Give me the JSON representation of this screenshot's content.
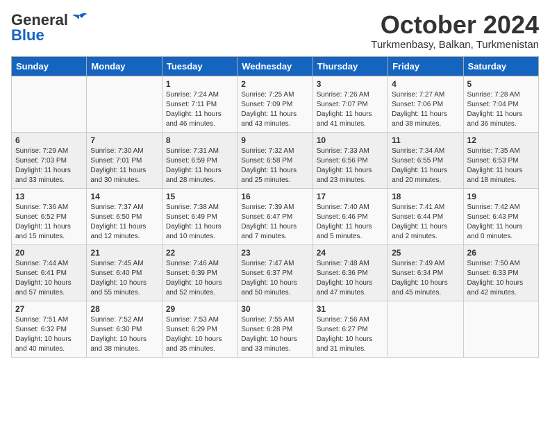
{
  "logo": {
    "general": "General",
    "blue": "Blue",
    "bird_unicode": "🐦"
  },
  "header": {
    "month": "October 2024",
    "location": "Turkmenbasy, Balkan, Turkmenistan"
  },
  "days_of_week": [
    "Sunday",
    "Monday",
    "Tuesday",
    "Wednesday",
    "Thursday",
    "Friday",
    "Saturday"
  ],
  "weeks": [
    [
      {
        "day": "",
        "info": ""
      },
      {
        "day": "",
        "info": ""
      },
      {
        "day": "1",
        "info": "Sunrise: 7:24 AM\nSunset: 7:11 PM\nDaylight: 11 hours and 46 minutes."
      },
      {
        "day": "2",
        "info": "Sunrise: 7:25 AM\nSunset: 7:09 PM\nDaylight: 11 hours and 43 minutes."
      },
      {
        "day": "3",
        "info": "Sunrise: 7:26 AM\nSunset: 7:07 PM\nDaylight: 11 hours and 41 minutes."
      },
      {
        "day": "4",
        "info": "Sunrise: 7:27 AM\nSunset: 7:06 PM\nDaylight: 11 hours and 38 minutes."
      },
      {
        "day": "5",
        "info": "Sunrise: 7:28 AM\nSunset: 7:04 PM\nDaylight: 11 hours and 36 minutes."
      }
    ],
    [
      {
        "day": "6",
        "info": "Sunrise: 7:29 AM\nSunset: 7:03 PM\nDaylight: 11 hours and 33 minutes."
      },
      {
        "day": "7",
        "info": "Sunrise: 7:30 AM\nSunset: 7:01 PM\nDaylight: 11 hours and 30 minutes."
      },
      {
        "day": "8",
        "info": "Sunrise: 7:31 AM\nSunset: 6:59 PM\nDaylight: 11 hours and 28 minutes."
      },
      {
        "day": "9",
        "info": "Sunrise: 7:32 AM\nSunset: 6:58 PM\nDaylight: 11 hours and 25 minutes."
      },
      {
        "day": "10",
        "info": "Sunrise: 7:33 AM\nSunset: 6:56 PM\nDaylight: 11 hours and 23 minutes."
      },
      {
        "day": "11",
        "info": "Sunrise: 7:34 AM\nSunset: 6:55 PM\nDaylight: 11 hours and 20 minutes."
      },
      {
        "day": "12",
        "info": "Sunrise: 7:35 AM\nSunset: 6:53 PM\nDaylight: 11 hours and 18 minutes."
      }
    ],
    [
      {
        "day": "13",
        "info": "Sunrise: 7:36 AM\nSunset: 6:52 PM\nDaylight: 11 hours and 15 minutes."
      },
      {
        "day": "14",
        "info": "Sunrise: 7:37 AM\nSunset: 6:50 PM\nDaylight: 11 hours and 12 minutes."
      },
      {
        "day": "15",
        "info": "Sunrise: 7:38 AM\nSunset: 6:49 PM\nDaylight: 11 hours and 10 minutes."
      },
      {
        "day": "16",
        "info": "Sunrise: 7:39 AM\nSunset: 6:47 PM\nDaylight: 11 hours and 7 minutes."
      },
      {
        "day": "17",
        "info": "Sunrise: 7:40 AM\nSunset: 6:46 PM\nDaylight: 11 hours and 5 minutes."
      },
      {
        "day": "18",
        "info": "Sunrise: 7:41 AM\nSunset: 6:44 PM\nDaylight: 11 hours and 2 minutes."
      },
      {
        "day": "19",
        "info": "Sunrise: 7:42 AM\nSunset: 6:43 PM\nDaylight: 11 hours and 0 minutes."
      }
    ],
    [
      {
        "day": "20",
        "info": "Sunrise: 7:44 AM\nSunset: 6:41 PM\nDaylight: 10 hours and 57 minutes."
      },
      {
        "day": "21",
        "info": "Sunrise: 7:45 AM\nSunset: 6:40 PM\nDaylight: 10 hours and 55 minutes."
      },
      {
        "day": "22",
        "info": "Sunrise: 7:46 AM\nSunset: 6:39 PM\nDaylight: 10 hours and 52 minutes."
      },
      {
        "day": "23",
        "info": "Sunrise: 7:47 AM\nSunset: 6:37 PM\nDaylight: 10 hours and 50 minutes."
      },
      {
        "day": "24",
        "info": "Sunrise: 7:48 AM\nSunset: 6:36 PM\nDaylight: 10 hours and 47 minutes."
      },
      {
        "day": "25",
        "info": "Sunrise: 7:49 AM\nSunset: 6:34 PM\nDaylight: 10 hours and 45 minutes."
      },
      {
        "day": "26",
        "info": "Sunrise: 7:50 AM\nSunset: 6:33 PM\nDaylight: 10 hours and 42 minutes."
      }
    ],
    [
      {
        "day": "27",
        "info": "Sunrise: 7:51 AM\nSunset: 6:32 PM\nDaylight: 10 hours and 40 minutes."
      },
      {
        "day": "28",
        "info": "Sunrise: 7:52 AM\nSunset: 6:30 PM\nDaylight: 10 hours and 38 minutes."
      },
      {
        "day": "29",
        "info": "Sunrise: 7:53 AM\nSunset: 6:29 PM\nDaylight: 10 hours and 35 minutes."
      },
      {
        "day": "30",
        "info": "Sunrise: 7:55 AM\nSunset: 6:28 PM\nDaylight: 10 hours and 33 minutes."
      },
      {
        "day": "31",
        "info": "Sunrise: 7:56 AM\nSunset: 6:27 PM\nDaylight: 10 hours and 31 minutes."
      },
      {
        "day": "",
        "info": ""
      },
      {
        "day": "",
        "info": ""
      }
    ]
  ]
}
